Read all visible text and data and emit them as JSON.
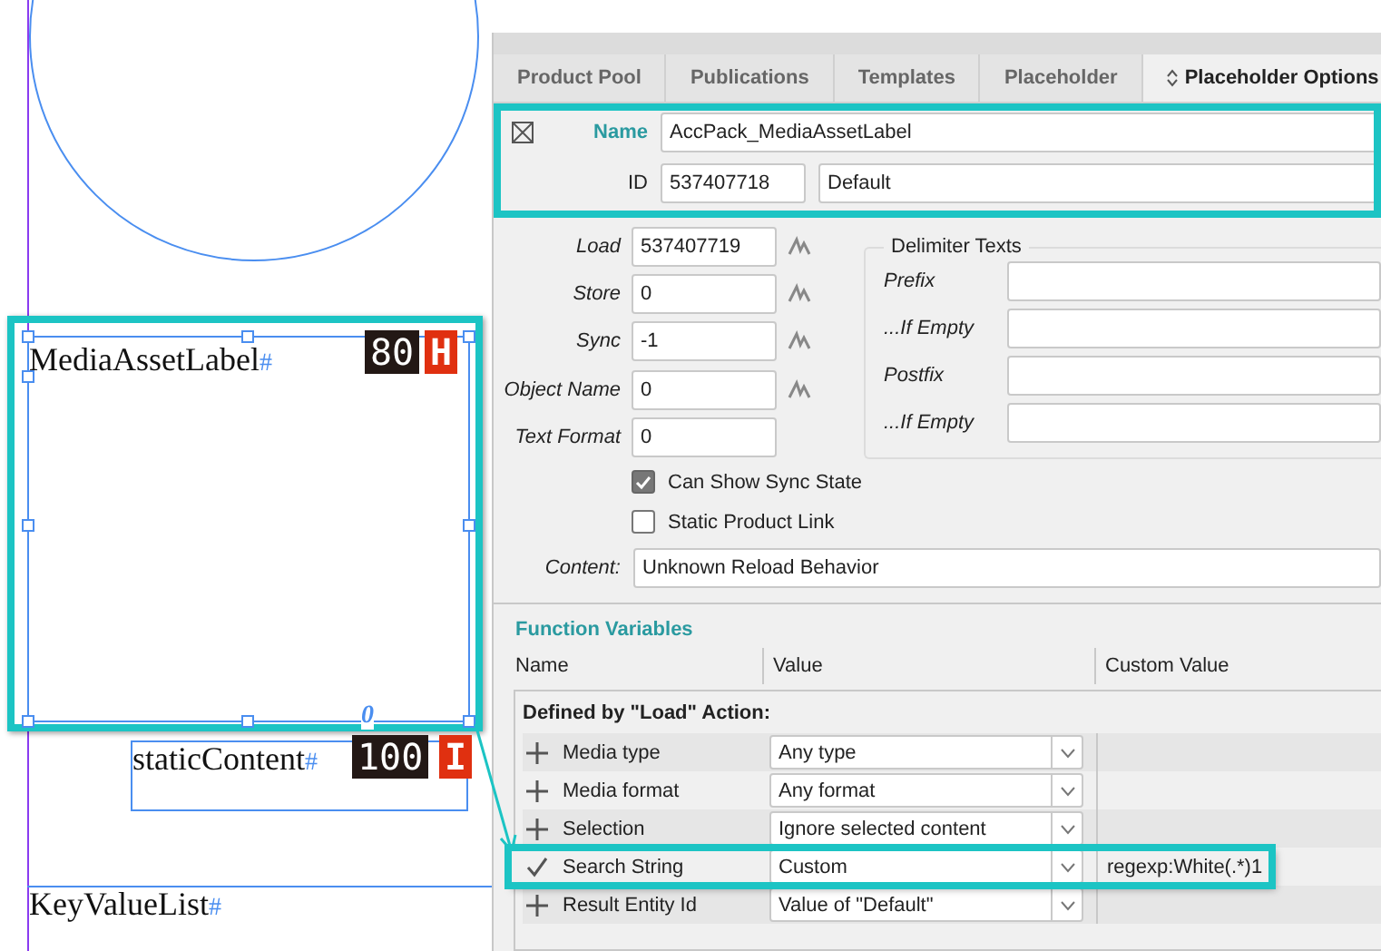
{
  "canvas": {
    "frames": [
      {
        "label": "MediaAssetLabel",
        "mark": "#",
        "badge_number": "80",
        "badge_letter": "H",
        "highlighted": true,
        "overset": "0"
      },
      {
        "label": "staticContent",
        "mark": "#",
        "badge_number": "100",
        "badge_letter": "I",
        "highlighted": false
      },
      {
        "label": "KeyValueList",
        "mark": "#"
      }
    ]
  },
  "tabs": [
    {
      "label": "Product Pool",
      "selected": false
    },
    {
      "label": "Publications",
      "selected": false
    },
    {
      "label": "Templates",
      "selected": false
    },
    {
      "label": "Placeholder",
      "selected": false
    },
    {
      "label": "Placeholder Options",
      "selected": true
    }
  ],
  "identity": {
    "highlighted": true,
    "name_label": "Name",
    "name_value": "AccPack_MediaAssetLabel",
    "id_label": "ID",
    "id_value": "537407718",
    "id_option": "Default"
  },
  "ids": [
    {
      "label": "Load",
      "value": "537407719",
      "linked": true
    },
    {
      "label": "Store",
      "value": "0",
      "linked": true
    },
    {
      "label": "Sync",
      "value": "-1",
      "linked": true
    },
    {
      "label": "Object Name",
      "value": "0",
      "linked": true
    },
    {
      "label": "Text Format",
      "value": "0",
      "linked": false
    }
  ],
  "delimiters": {
    "title": "Delimiter Texts",
    "fields": [
      {
        "label": "Prefix"
      },
      {
        "label": "...If Empty"
      },
      {
        "label": "Postfix"
      },
      {
        "label": "...If Empty"
      }
    ]
  },
  "checkboxes": [
    {
      "label": "Can Show Sync State",
      "checked": true
    },
    {
      "label": "Static Product Link",
      "checked": false
    }
  ],
  "content": {
    "label": "Content:",
    "value": "Unknown Reload Behavior"
  },
  "function_variables": {
    "title": "Function Variables",
    "columns": [
      "Name",
      "Value",
      "Custom Value"
    ],
    "group": "Defined by \"Load\" Action:",
    "rows": [
      {
        "name": "Media type",
        "value": "Any type",
        "set": false,
        "highlighted": false
      },
      {
        "name": "Media format",
        "value": "Any format",
        "set": false,
        "highlighted": false
      },
      {
        "name": "Selection",
        "value": "Ignore selected content",
        "set": false,
        "highlighted": false
      },
      {
        "name": "Search String",
        "value": "Custom",
        "custom_value": "regexp:White(.*)1",
        "set": true,
        "highlighted": true
      },
      {
        "name": "Result Entity Id",
        "value": "Value of \"Default\"",
        "set": false,
        "highlighted": false
      }
    ]
  }
}
